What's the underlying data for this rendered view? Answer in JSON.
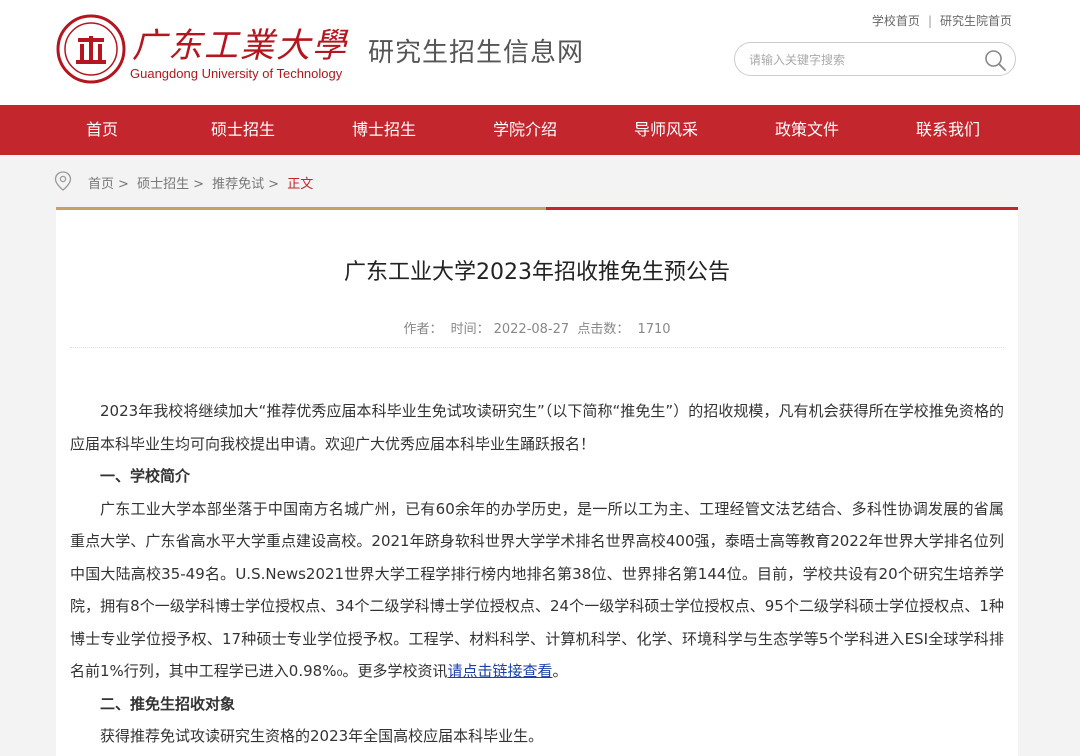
{
  "header": {
    "logo_cn": "广东工業大學",
    "logo_en": "Guangdong University of Technology",
    "site_name": "研究生招生信息网",
    "toplinks": [
      {
        "label": "学校首页"
      },
      {
        "label": "研究生院首页"
      }
    ],
    "toplinks_sep": "|",
    "search": {
      "placeholder": "请输入关键字搜索",
      "icon": "search-icon"
    }
  },
  "nav": {
    "items": [
      {
        "label": "首页"
      },
      {
        "label": "硕士招生"
      },
      {
        "label": "博士招生"
      },
      {
        "label": "学院介绍"
      },
      {
        "label": "导师风采"
      },
      {
        "label": "政策文件"
      },
      {
        "label": "联系我们"
      }
    ]
  },
  "breadcrumb": {
    "icon": "location-pin-icon",
    "items": [
      "首页",
      "硕士招生",
      "推荐免试"
    ],
    "sep": ">",
    "current": "正文"
  },
  "article": {
    "title": "广东工业大学2023年招收推免生预公告",
    "meta": {
      "author_label": "作者：",
      "time_label": "时间：",
      "time": "2022-08-27",
      "hits_label": "点击数：",
      "hits": "1710"
    },
    "intro": "2023年我校将继续加大“推荐优秀应届本科毕业生免试攻读研究生”（以下简称“推免生”）的招收规模，凡有机会获得所在学校推免资格的应届本科毕业生均可向我校提出申请。欢迎广大优秀应届本科毕业生踊跃报名！",
    "section1_title": "一、学校简介",
    "section1_text": "广东工业大学本部坐落于中国南方名城广州，已有60余年的办学历史，是一所以工为主、工理经管文法艺结合、多科性协调发展的省属重点大学、广东省高水平大学重点建设高校。2021年跻身软科世界大学学术排名世界高校400强，泰晤士高等教育2022年世界大学排名位列中国大陆高校35-49名。U.S.News2021世界大学工程学排行榜内地排名第38位、世界排名第144位。目前，学校共设有20个研究生培养学院，拥有8个一级学科博士学位授权点、34个二级学科博士学位授权点、24个一级学科硕士学位授权点、95个二级学科硕士学位授权点、1种博士专业学位授予权、17种硕士专业学位授予权。工程学、材料科学、计算机科学、化学、环境科学与生态学等5个学科进入ESI全球学科排名前1%行列，其中工程学已进入0.98%₀。更多学校资讯",
    "section1_link": "请点击链接查看",
    "section1_end": "。",
    "section2_title": "二、推免生招收对象",
    "section2_text": "获得推荐免试攻读研究生资格的2023年全国高校应届本科毕业生。"
  },
  "colors": {
    "brand_red": "#c3262c",
    "gold": "#c8a064",
    "link": "#1a3fa8"
  }
}
